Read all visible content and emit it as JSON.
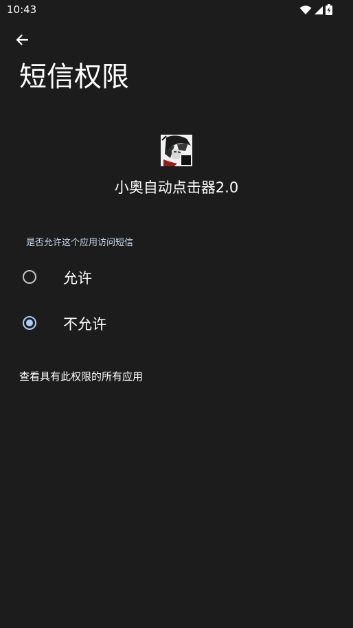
{
  "status_bar": {
    "time": "10:43",
    "icons": [
      "wifi-icon",
      "cellular-signal-icon",
      "battery-charging-icon"
    ]
  },
  "header": {
    "back_icon": "arrow-back-icon",
    "title": "短信权限"
  },
  "app": {
    "icon": "app-icon",
    "name": "小奥自动点击器2.0"
  },
  "permission": {
    "question": "是否允许这个应用访问短信",
    "options": [
      {
        "label": "允许",
        "selected": false
      },
      {
        "label": "不允许",
        "selected": true
      }
    ]
  },
  "footer": {
    "view_all_link": "查看具有此权限的所有应用"
  },
  "colors": {
    "background": "#1c1c1c",
    "accent": "#aecbfa",
    "label_muted": "#c9d7ea"
  }
}
